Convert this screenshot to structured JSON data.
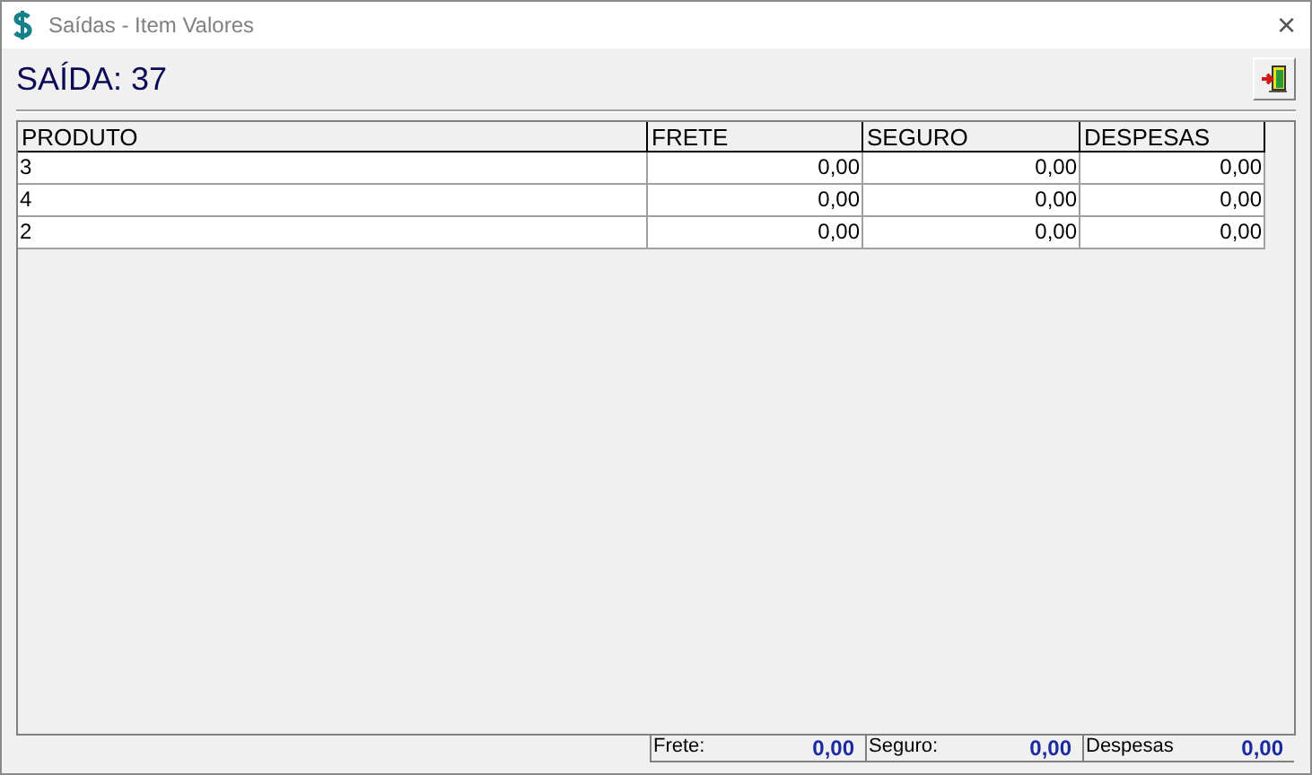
{
  "window": {
    "title": "Saídas - Item Valores",
    "close": "×"
  },
  "heading": "SAÍDA: 37",
  "table": {
    "columns": [
      "PRODUTO",
      "FRETE",
      "SEGURO",
      "DESPESAS"
    ],
    "rows": [
      [
        "3",
        "0,00",
        "0,00",
        "0,00"
      ],
      [
        "4",
        "0,00",
        "0,00",
        "0,00"
      ],
      [
        "2",
        "0,00",
        "0,00",
        "0,00"
      ]
    ]
  },
  "totals": [
    {
      "label": "Frete:",
      "value": "0,00"
    },
    {
      "label": "Seguro:",
      "value": "0,00"
    },
    {
      "label": "Despesas",
      "value": "0,00"
    }
  ]
}
